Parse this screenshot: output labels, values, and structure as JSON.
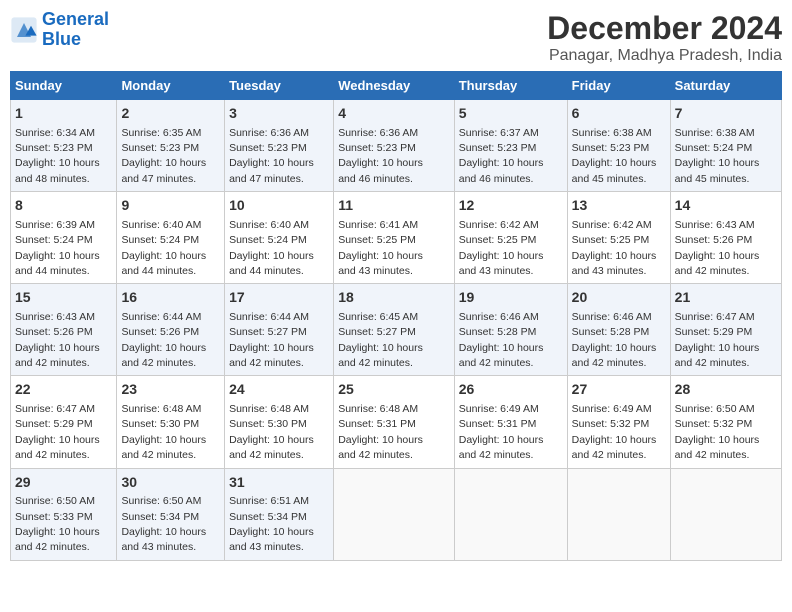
{
  "header": {
    "logo_line1": "General",
    "logo_line2": "Blue",
    "title": "December 2024",
    "subtitle": "Panagar, Madhya Pradesh, India"
  },
  "days_of_week": [
    "Sunday",
    "Monday",
    "Tuesday",
    "Wednesday",
    "Thursday",
    "Friday",
    "Saturday"
  ],
  "weeks": [
    [
      {
        "day": "1",
        "sunrise": "6:34 AM",
        "sunset": "5:23 PM",
        "daylight": "10 hours and 48 minutes."
      },
      {
        "day": "2",
        "sunrise": "6:35 AM",
        "sunset": "5:23 PM",
        "daylight": "10 hours and 47 minutes."
      },
      {
        "day": "3",
        "sunrise": "6:36 AM",
        "sunset": "5:23 PM",
        "daylight": "10 hours and 47 minutes."
      },
      {
        "day": "4",
        "sunrise": "6:36 AM",
        "sunset": "5:23 PM",
        "daylight": "10 hours and 46 minutes."
      },
      {
        "day": "5",
        "sunrise": "6:37 AM",
        "sunset": "5:23 PM",
        "daylight": "10 hours and 46 minutes."
      },
      {
        "day": "6",
        "sunrise": "6:38 AM",
        "sunset": "5:23 PM",
        "daylight": "10 hours and 45 minutes."
      },
      {
        "day": "7",
        "sunrise": "6:38 AM",
        "sunset": "5:24 PM",
        "daylight": "10 hours and 45 minutes."
      }
    ],
    [
      {
        "day": "8",
        "sunrise": "6:39 AM",
        "sunset": "5:24 PM",
        "daylight": "10 hours and 44 minutes."
      },
      {
        "day": "9",
        "sunrise": "6:40 AM",
        "sunset": "5:24 PM",
        "daylight": "10 hours and 44 minutes."
      },
      {
        "day": "10",
        "sunrise": "6:40 AM",
        "sunset": "5:24 PM",
        "daylight": "10 hours and 44 minutes."
      },
      {
        "day": "11",
        "sunrise": "6:41 AM",
        "sunset": "5:25 PM",
        "daylight": "10 hours and 43 minutes."
      },
      {
        "day": "12",
        "sunrise": "6:42 AM",
        "sunset": "5:25 PM",
        "daylight": "10 hours and 43 minutes."
      },
      {
        "day": "13",
        "sunrise": "6:42 AM",
        "sunset": "5:25 PM",
        "daylight": "10 hours and 43 minutes."
      },
      {
        "day": "14",
        "sunrise": "6:43 AM",
        "sunset": "5:26 PM",
        "daylight": "10 hours and 42 minutes."
      }
    ],
    [
      {
        "day": "15",
        "sunrise": "6:43 AM",
        "sunset": "5:26 PM",
        "daylight": "10 hours and 42 minutes."
      },
      {
        "day": "16",
        "sunrise": "6:44 AM",
        "sunset": "5:26 PM",
        "daylight": "10 hours and 42 minutes."
      },
      {
        "day": "17",
        "sunrise": "6:44 AM",
        "sunset": "5:27 PM",
        "daylight": "10 hours and 42 minutes."
      },
      {
        "day": "18",
        "sunrise": "6:45 AM",
        "sunset": "5:27 PM",
        "daylight": "10 hours and 42 minutes."
      },
      {
        "day": "19",
        "sunrise": "6:46 AM",
        "sunset": "5:28 PM",
        "daylight": "10 hours and 42 minutes."
      },
      {
        "day": "20",
        "sunrise": "6:46 AM",
        "sunset": "5:28 PM",
        "daylight": "10 hours and 42 minutes."
      },
      {
        "day": "21",
        "sunrise": "6:47 AM",
        "sunset": "5:29 PM",
        "daylight": "10 hours and 42 minutes."
      }
    ],
    [
      {
        "day": "22",
        "sunrise": "6:47 AM",
        "sunset": "5:29 PM",
        "daylight": "10 hours and 42 minutes."
      },
      {
        "day": "23",
        "sunrise": "6:48 AM",
        "sunset": "5:30 PM",
        "daylight": "10 hours and 42 minutes."
      },
      {
        "day": "24",
        "sunrise": "6:48 AM",
        "sunset": "5:30 PM",
        "daylight": "10 hours and 42 minutes."
      },
      {
        "day": "25",
        "sunrise": "6:48 AM",
        "sunset": "5:31 PM",
        "daylight": "10 hours and 42 minutes."
      },
      {
        "day": "26",
        "sunrise": "6:49 AM",
        "sunset": "5:31 PM",
        "daylight": "10 hours and 42 minutes."
      },
      {
        "day": "27",
        "sunrise": "6:49 AM",
        "sunset": "5:32 PM",
        "daylight": "10 hours and 42 minutes."
      },
      {
        "day": "28",
        "sunrise": "6:50 AM",
        "sunset": "5:32 PM",
        "daylight": "10 hours and 42 minutes."
      }
    ],
    [
      {
        "day": "29",
        "sunrise": "6:50 AM",
        "sunset": "5:33 PM",
        "daylight": "10 hours and 42 minutes."
      },
      {
        "day": "30",
        "sunrise": "6:50 AM",
        "sunset": "5:34 PM",
        "daylight": "10 hours and 43 minutes."
      },
      {
        "day": "31",
        "sunrise": "6:51 AM",
        "sunset": "5:34 PM",
        "daylight": "10 hours and 43 minutes."
      },
      null,
      null,
      null,
      null
    ]
  ]
}
